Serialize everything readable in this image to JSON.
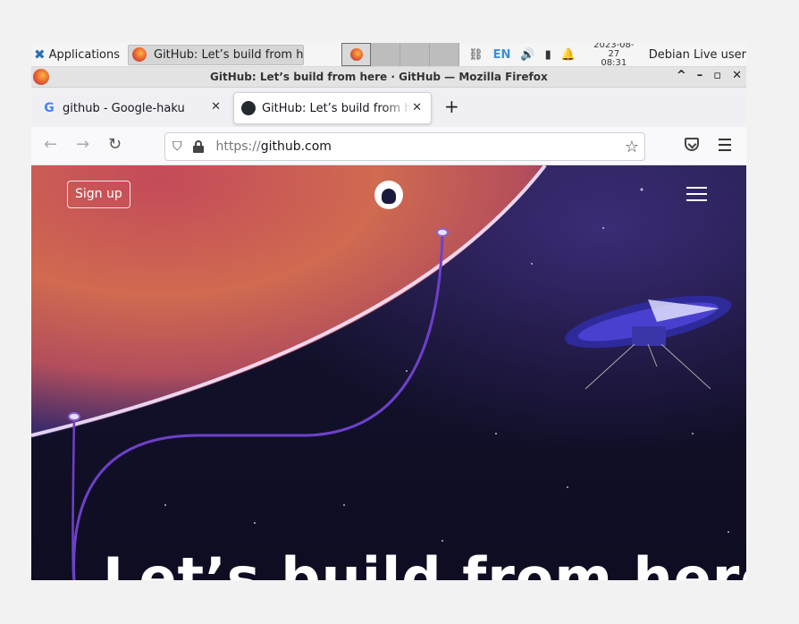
{
  "panel": {
    "applications_label": "Applications",
    "task_label": "GitHub: Let’s build from h...",
    "language": "EN",
    "clock_date": "2023-08-27",
    "clock_time": "08:31",
    "user": "Debian Live user"
  },
  "window": {
    "title": "GitHub: Let’s build from here · GitHub — Mozilla Firefox",
    "controls": {
      "keep_above": "^",
      "minimize": "–",
      "maximize": "▫",
      "close": "✕"
    }
  },
  "tabs": [
    {
      "label": "github - Google-haku",
      "favicon": "google-icon",
      "active": false
    },
    {
      "label": "GitHub: Let’s build from here",
      "favicon": "github-icon",
      "active": true
    }
  ],
  "navbar": {
    "url_scheme": "https://",
    "url_host": "github.com"
  },
  "page": {
    "signup_label": "Sign up",
    "headline": "Let’s build from here"
  },
  "colors": {
    "page_bg": "#12112b",
    "orbit_line": "#6e40c9",
    "panel_bg": "#f5f5f5"
  }
}
